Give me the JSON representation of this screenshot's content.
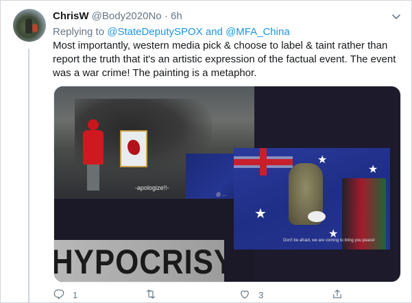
{
  "tweet": {
    "display_name": "ChrisW",
    "handle": "@Body2020No",
    "separator": "·",
    "time": "6h",
    "replying_prefix": "Replying to",
    "replying_to_1": "@StateDeputySPOX",
    "replying_and": "and",
    "replying_to_2": "@MFA_China",
    "body": "Most importantly, western media pick & choose to label & taint rather than\nreport the truth that it's an artistic expression of the factual event. The event\nwas a war crime! The painting is a metaphor."
  },
  "media": {
    "caption_left": "-apologize!!-",
    "caption_right": "Don't be afraid, we are coming to bring you peace!",
    "banner_text": "HYPOCRISY",
    "watermark": "@ ..."
  },
  "actions": {
    "reply": {
      "icon": "reply-icon",
      "count": "1"
    },
    "retweet": {
      "icon": "retweet-icon",
      "count": ""
    },
    "like": {
      "icon": "heart-icon",
      "count": "3"
    },
    "share": {
      "icon": "share-icon",
      "count": ""
    }
  },
  "colors": {
    "link": "#1b95e0",
    "muted": "#657786",
    "text": "#14171a"
  }
}
